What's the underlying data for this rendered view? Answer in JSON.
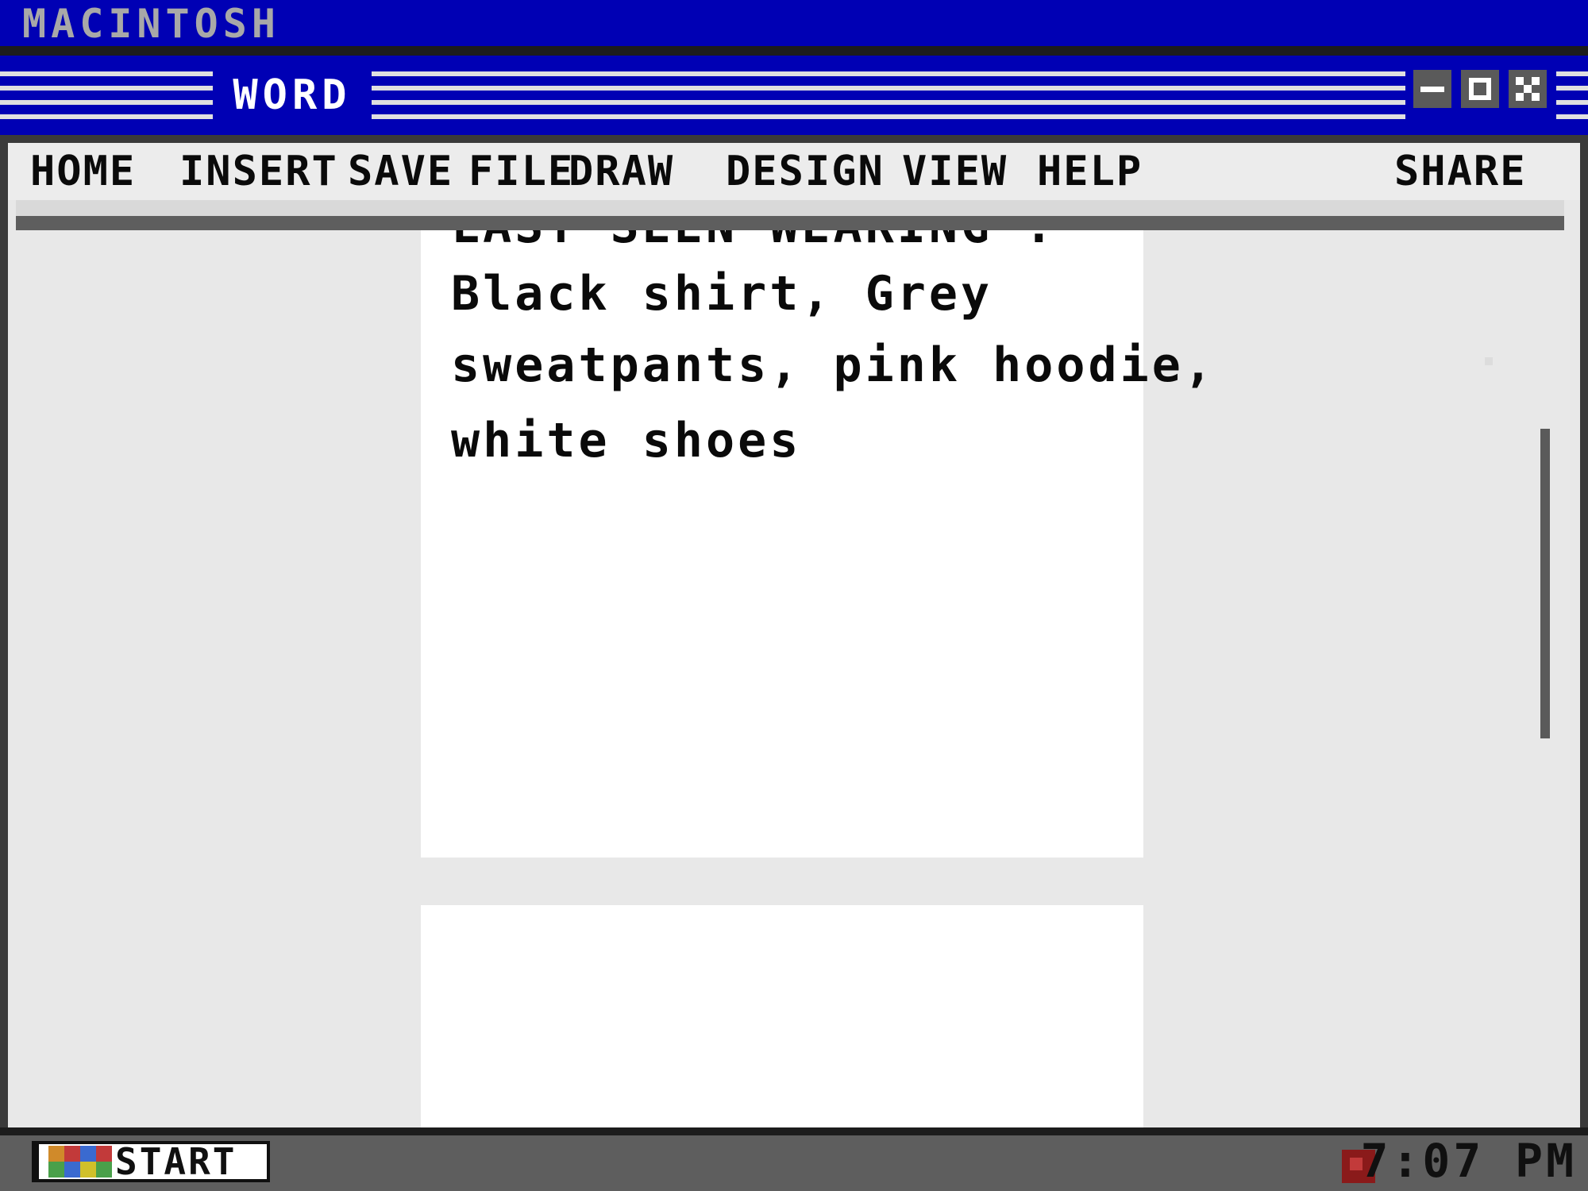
{
  "system": {
    "title": "MACINTOSH"
  },
  "window": {
    "app_name": "WORD",
    "controls": {
      "minimize": "minimize-icon",
      "maximize": "maximize-icon",
      "close": "close-icon"
    }
  },
  "menu": {
    "items": [
      "HOME",
      "INSERT",
      "SAVE",
      "FILE",
      "DRAW",
      "DESIGN",
      "VIEW",
      "HELP"
    ],
    "share": "SHARE"
  },
  "document": {
    "lines": [
      "LAST SEEN WEARING :",
      "Black shirt, Grey",
      "sweatpants, pink hoodie,",
      "white shoes"
    ]
  },
  "taskbar": {
    "start_label": "START",
    "clock": "7:07 PM"
  },
  "colors": {
    "title_bar": "#0000b4",
    "chrome_dark": "#3a3a3a",
    "taskbar": "#5e5e5e",
    "page": "#ffffff"
  }
}
